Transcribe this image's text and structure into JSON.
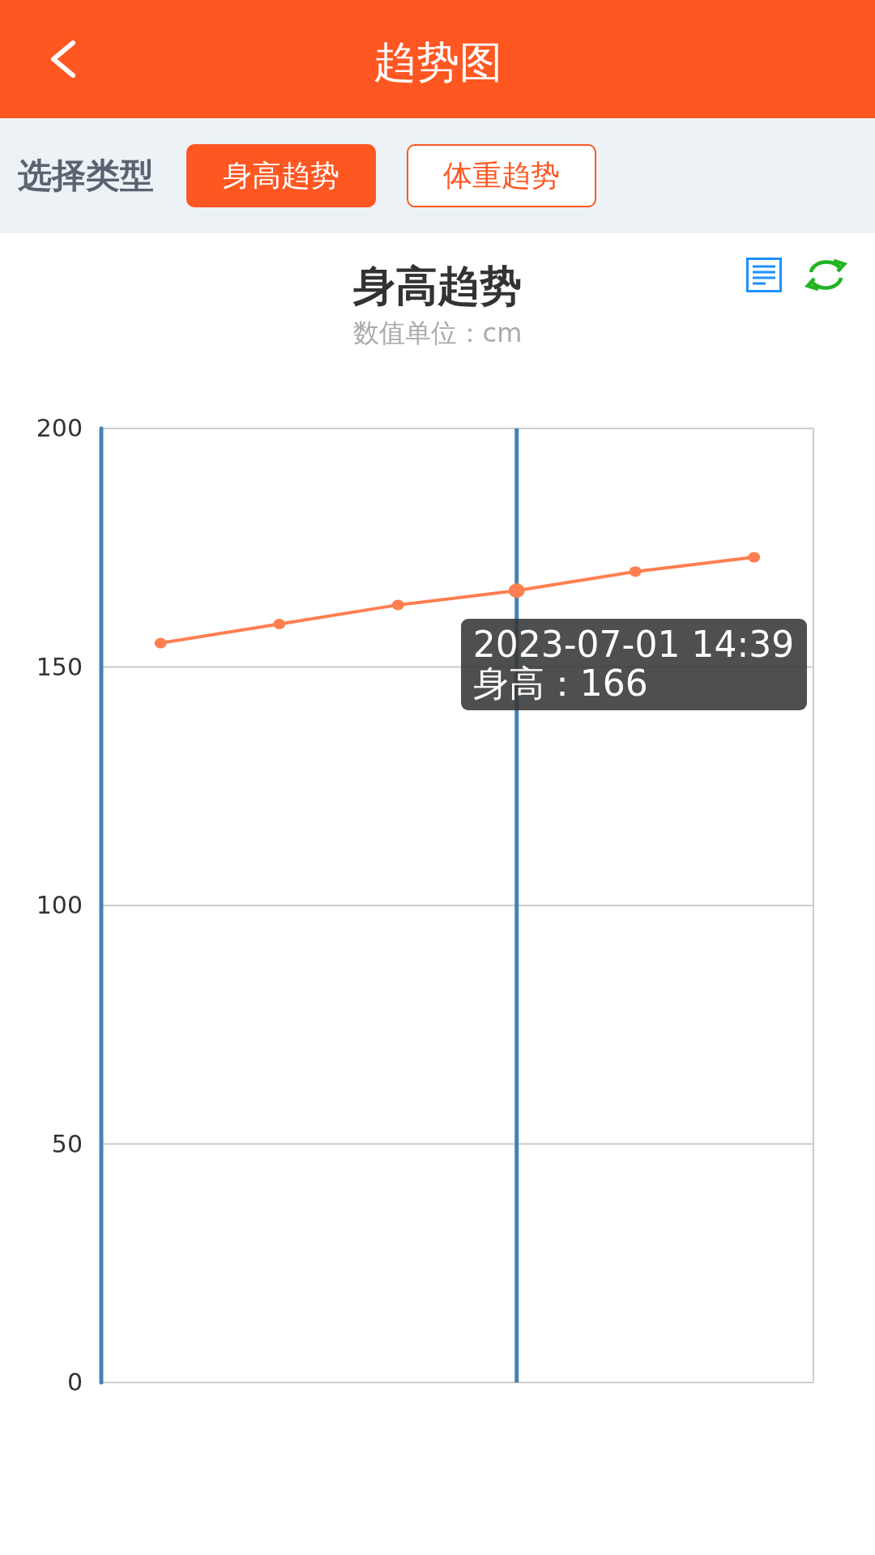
{
  "header": {
    "title": "趋势图"
  },
  "filter": {
    "label": "选择类型",
    "tabs": [
      {
        "label": "身高趋势",
        "selected": true
      },
      {
        "label": "体重趋势",
        "selected": false
      }
    ]
  },
  "chart": {
    "title": "身高趋势",
    "subtitle": "数值单位：cm",
    "chart_data": {
      "type": "line",
      "grid": true,
      "series": [
        {
          "color": "#ff7f50",
          "marker": true,
          "values": [
            155,
            159,
            163,
            166,
            170,
            173
          ]
        }
      ],
      "ylim": [
        0,
        200
      ],
      "yticks": [
        0,
        50,
        100,
        150,
        200
      ]
    },
    "points": [
      {
        "selected": false
      },
      {
        "selected": false
      },
      {
        "selected": false
      },
      {
        "selected": true
      },
      {
        "selected": false
      },
      {
        "selected": false
      }
    ],
    "tooltip": {
      "title": "2023-07-01 14:39",
      "text": "身高：166"
    }
  }
}
